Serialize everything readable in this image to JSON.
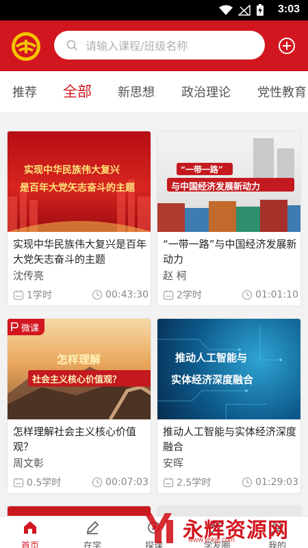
{
  "status_bar": {
    "time": "3:03"
  },
  "header": {
    "search_placeholder": "请输入课程/班级名称",
    "brand_color": "#d2161f"
  },
  "tabs": [
    {
      "label": "推荐",
      "active": false
    },
    {
      "label": "全部",
      "active": true
    },
    {
      "label": "新思想",
      "active": false
    },
    {
      "label": "政治理论",
      "active": false
    },
    {
      "label": "党性教育",
      "active": false
    }
  ],
  "courses": [
    {
      "thumb_lines": [
        "实现中华民族伟大复兴",
        "是百年大党矢志奋斗的主题"
      ],
      "title": "实现中华民族伟大复兴是百年大党矢志奋斗的主题",
      "author": "沈传亮",
      "hours": "1学时",
      "duration": "00:43:30"
    },
    {
      "thumb_lines": [
        "“一带一路”",
        "与中国经济发展新动力"
      ],
      "title": "“一带一路”与中国经济发展新动力",
      "author": "赵 柯",
      "hours": "2学时",
      "duration": "01:01:10"
    },
    {
      "badge": "微课",
      "thumb_lines": [
        "怎样理解",
        "社会主义核心价值观？"
      ],
      "title": "怎样理解社会主义核心价值观？",
      "author": "周文彰",
      "hours": "0.5学时",
      "duration": "00:07:03"
    },
    {
      "thumb_lines": [
        "推动人工智能与",
        "实体经济深度融合"
      ],
      "title": "推动人工智能与实体经济深度融合",
      "author": "安晖",
      "hours": "2.5学时",
      "duration": "01:29:03"
    }
  ],
  "bottom_nav": [
    {
      "label": "首页",
      "icon": "home-icon",
      "active": true
    },
    {
      "label": "在学",
      "icon": "pencil-icon",
      "active": false
    },
    {
      "label": "探课",
      "icon": "explore-icon",
      "active": false
    },
    {
      "label": "学友圈",
      "icon": "friends-icon",
      "active": false
    },
    {
      "label": "我的",
      "icon": "profile-icon",
      "active": false
    }
  ],
  "watermark": {
    "text": "永辉资源网",
    "url": "www.yhkjjj.com"
  }
}
